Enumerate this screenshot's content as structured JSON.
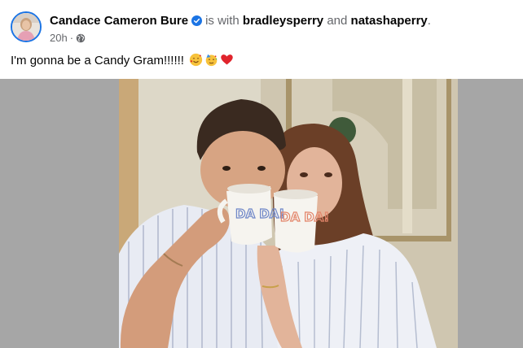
{
  "post": {
    "author": "Candace Cameron Bure",
    "is_with": "is with",
    "tagged_1": "bradleysperry",
    "and": "and",
    "tagged_2": "natashaperry",
    "period": ".",
    "time": "20h",
    "separator": "·",
    "privacy_icon": "globe-icon",
    "caption": "I'm gonna be a Candy Gram!!!!!!",
    "caption_emojis": [
      "smiling-face-with-hearts",
      "partying-face",
      "red-heart"
    ],
    "mug_left_text": "DA DA!",
    "mug_right_text": "DA DA!"
  },
  "colors": {
    "verified": "#1b74e4",
    "secondary_text": "#65676b",
    "photo_backdrop": "#a6a6a6",
    "heart": "#e0242c"
  }
}
